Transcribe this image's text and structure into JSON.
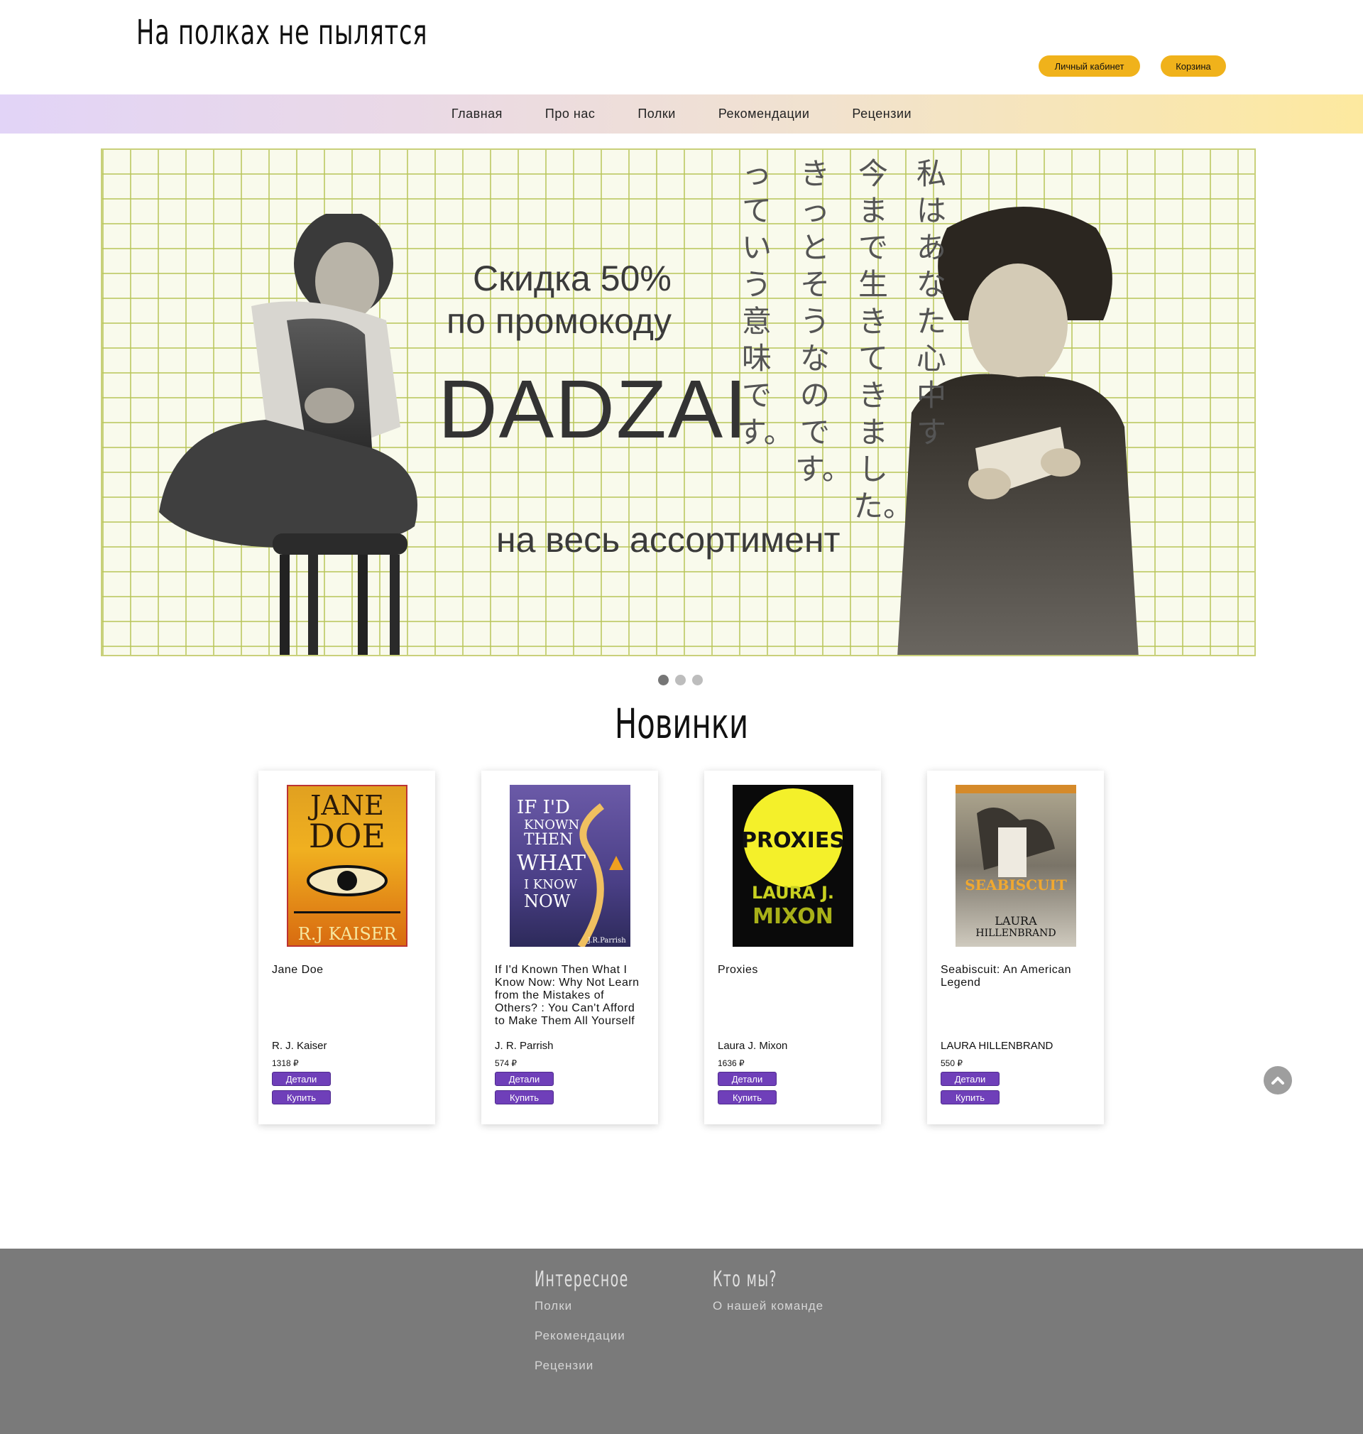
{
  "header": {
    "logo": "На полках не пылятся",
    "account_label": "Личный кабинет",
    "cart_label": "Корзина"
  },
  "nav": {
    "items": [
      {
        "label": "Главная"
      },
      {
        "label": "Про нас"
      },
      {
        "label": "Полки"
      },
      {
        "label": "Рекомендации"
      },
      {
        "label": "Рецензии"
      }
    ]
  },
  "banner": {
    "line1": "Скидка 50%",
    "line2": "по промокоду",
    "code": "DADZAI",
    "line3": "на весь ассортимент",
    "jp_columns": [
      "私はあなた心中す",
      "今まで生きてきました。",
      "きっとそうなのです。",
      "っていう意味です。"
    ],
    "slides": 3,
    "active_slide": 1
  },
  "new_books": {
    "title": "Новинки",
    "books": [
      {
        "title": "Jane Doe",
        "author": "R. J. Kaiser",
        "price": "1318 ₽",
        "details_label": "Детали",
        "buy_label": "Купить",
        "cover_text": [
          "JANE",
          "DOE",
          "R.J KAISER"
        ]
      },
      {
        "title": "If I'd Known Then What I Know Now: Why Not Learn from the Mistakes of Others? : You Can't Afford to Make Them All Yourself",
        "author": "J. R. Parrish",
        "price": "574 ₽",
        "details_label": "Детали",
        "buy_label": "Купить",
        "cover_text": [
          "IF I'D",
          "KNOWN",
          "THEN",
          "WHAT",
          "I KNOW",
          "NOW",
          "J.R.Parrish"
        ]
      },
      {
        "title": "Proxies",
        "author": "Laura J. Mixon",
        "price": "1636 ₽",
        "details_label": "Детали",
        "buy_label": "Купить",
        "cover_text": [
          "PROXIES",
          "LAURA J.",
          "MIXON"
        ]
      },
      {
        "title": "Seabiscuit: An American Legend",
        "author": "LAURA HILLENBRAND",
        "price": "550 ₽",
        "details_label": "Детали",
        "buy_label": "Купить",
        "cover_text": [
          "SEABISCUIT",
          "LAURA",
          "HILLENBRAND"
        ]
      }
    ]
  },
  "footer": {
    "col1_title": "Интересное",
    "col1_links": [
      {
        "label": "Полки"
      },
      {
        "label": "Рекомендации"
      },
      {
        "label": "Рецензии"
      }
    ],
    "col2_title": "Кто мы?",
    "col2_links": [
      {
        "label": "О нашей команде"
      }
    ]
  },
  "colors": {
    "accent_yellow": "#f0b21b",
    "button_purple": "#6f3fb9",
    "footer_gray": "#7a7a7a"
  }
}
